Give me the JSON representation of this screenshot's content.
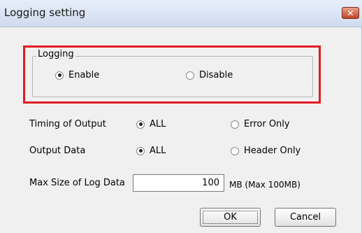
{
  "window": {
    "title": "Logging setting",
    "close_icon": "close-icon"
  },
  "logging_group": {
    "legend": "Logging",
    "options": [
      {
        "label": "Enable",
        "selected": true
      },
      {
        "label": "Disable",
        "selected": false
      }
    ]
  },
  "timing_of_output": {
    "label": "Timing of Output",
    "options": [
      {
        "label": "ALL",
        "selected": true
      },
      {
        "label": "Error Only",
        "selected": false
      }
    ]
  },
  "output_data": {
    "label": "Output Data",
    "options": [
      {
        "label": "ALL",
        "selected": true
      },
      {
        "label": "Header Only",
        "selected": false
      }
    ]
  },
  "max_size": {
    "label": "Max Size of Log Data",
    "value": "100",
    "unit": "MB  (Max 100MB)"
  },
  "buttons": {
    "ok": "OK",
    "cancel": "Cancel"
  },
  "colors": {
    "highlight": "#e11b22",
    "dialog_bg": "#f0f0f0"
  }
}
